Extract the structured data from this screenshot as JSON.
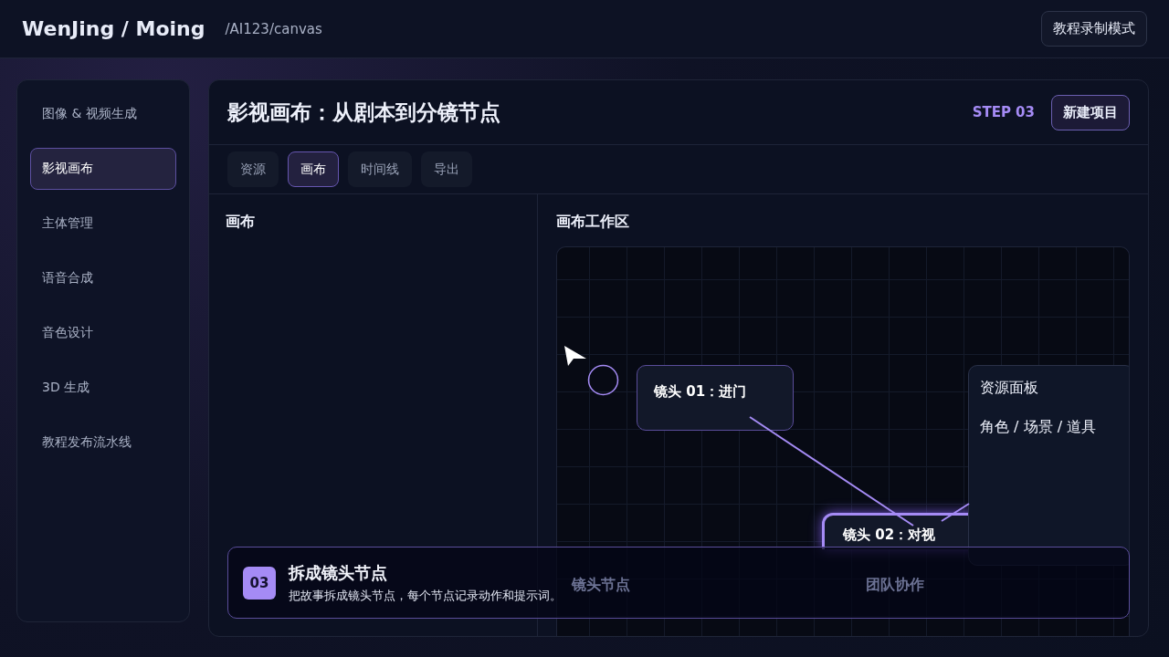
{
  "header": {
    "brand": "WenJing / Moing",
    "path": "/AI123/canvas",
    "mode_button": "教程录制模式"
  },
  "sidebar": {
    "items": [
      {
        "label": "图像 & 视频生成",
        "selected": false
      },
      {
        "label": "影视画布",
        "selected": true
      },
      {
        "label": "主体管理",
        "selected": false
      },
      {
        "label": "语音合成",
        "selected": false
      },
      {
        "label": "音色设计",
        "selected": false
      },
      {
        "label": "3D 生成",
        "selected": false
      },
      {
        "label": "教程发布流水线",
        "selected": false
      }
    ]
  },
  "page": {
    "title": "影视画布：从剧本到分镜节点",
    "step": "STEP 03",
    "new_button": "新建项目"
  },
  "tabs": [
    {
      "label": "资源",
      "selected": false
    },
    {
      "label": "画布",
      "selected": true
    },
    {
      "label": "时间线",
      "selected": false
    },
    {
      "label": "导出",
      "selected": false
    }
  ],
  "left_panel": {
    "title": "画布"
  },
  "workspace": {
    "title": "画布工作区",
    "nodes": [
      {
        "label": "镜头 01：进门",
        "selected": false
      },
      {
        "label": "镜头 02：对视",
        "selected": true
      }
    ],
    "resource_panel": {
      "title": "资源面板",
      "text": "角色 / 场景 / 道具"
    },
    "faint_labels": [
      "镜头节点",
      "团队协作"
    ]
  },
  "caption": {
    "number": "03",
    "title": "拆成镜头节点",
    "text": "把故事拆成镜头节点，每个节点记录动作和提示词。"
  }
}
